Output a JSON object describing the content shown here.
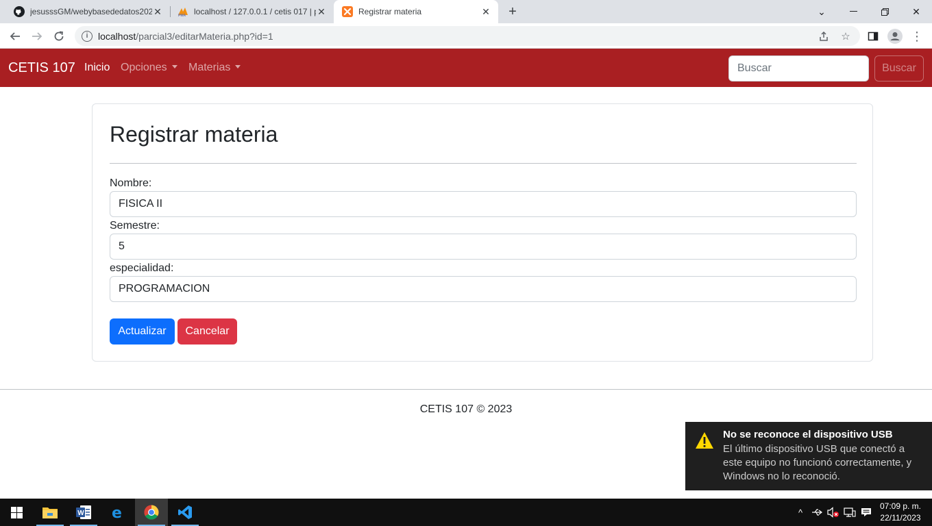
{
  "browser": {
    "tabs": [
      {
        "title": "jesusssGM/webybasededatos202",
        "favicon": "github-icon",
        "active": false
      },
      {
        "title": "localhost / 127.0.0.1 / cetis 017 | p",
        "favicon": "phpmyadmin-icon",
        "active": false
      },
      {
        "title": "Registrar materia",
        "favicon": "xampp-icon",
        "active": true
      }
    ],
    "url_host": "localhost",
    "url_path": "/parcial3/editarMateria.php?id=1"
  },
  "navbar": {
    "brand": "CETIS 107",
    "links": [
      {
        "label": "Inicio",
        "active": true
      },
      {
        "label": "Opciones",
        "dropdown": true
      },
      {
        "label": "Materias",
        "dropdown": true
      }
    ],
    "search_placeholder": "Buscar",
    "search_button": "Buscar",
    "color": "#a91f22"
  },
  "form": {
    "title": "Registrar materia",
    "fields": [
      {
        "label": "Nombre:",
        "value": "FISICA II"
      },
      {
        "label": "Semestre:",
        "value": "5"
      },
      {
        "label": "especialidad:",
        "value": "PROGRAMACION"
      }
    ],
    "submit_label": "Actualizar",
    "cancel_label": "Cancelar"
  },
  "footer": {
    "text": "CETIS 107 © 2023"
  },
  "notification": {
    "title": "No se reconoce el dispositivo USB",
    "body": "El último dispositivo USB que conectó a este equipo no funcionó correctamente, y Windows no lo reconoció.",
    "icon": "warning-icon"
  },
  "taskbar": {
    "apps": [
      "file-explorer-icon",
      "word-icon",
      "edge-icon",
      "chrome-icon",
      "vscode-icon"
    ],
    "time": "07:09 p. m.",
    "date": "22/11/2023"
  }
}
